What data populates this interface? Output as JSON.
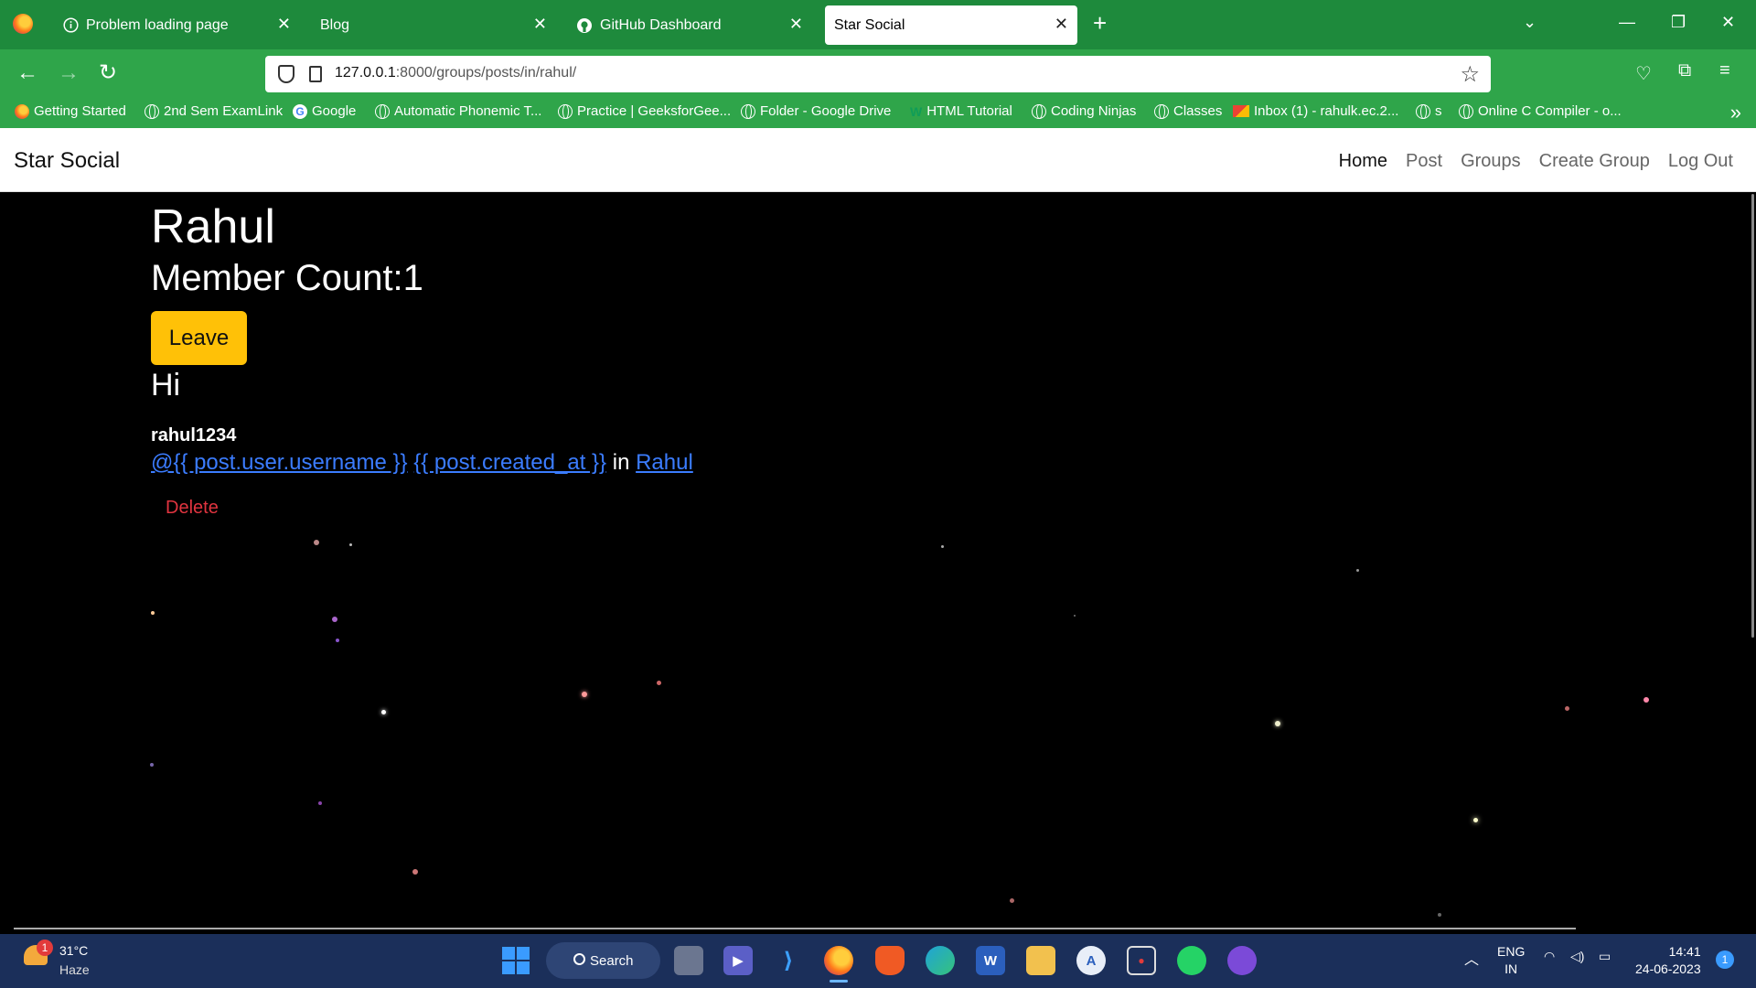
{
  "browser": {
    "tabs": [
      {
        "title": "Problem loading page",
        "icon": "info-icon",
        "active": false
      },
      {
        "title": "Blog",
        "icon": "none",
        "active": false
      },
      {
        "title": "GitHub Dashboard",
        "icon": "github-icon",
        "active": false
      },
      {
        "title": "Star Social",
        "icon": "none",
        "active": true
      }
    ],
    "url_host": "127.0.0.1",
    "url_rest": ":8000/groups/posts/in/rahul/",
    "bookmarks": [
      {
        "label": "Getting Started",
        "icon": "firefox-icon"
      },
      {
        "label": "2nd Sem ExamLink",
        "icon": "globe-icon"
      },
      {
        "label": "Google",
        "icon": "google-icon"
      },
      {
        "label": "Automatic Phonemic T...",
        "icon": "globe-icon"
      },
      {
        "label": "Practice | GeeksforGee...",
        "icon": "globe-icon"
      },
      {
        "label": "Folder - Google Drive",
        "icon": "globe-icon"
      },
      {
        "label": "HTML Tutorial",
        "icon": "w3schools-icon"
      },
      {
        "label": "Coding Ninjas",
        "icon": "globe-icon"
      },
      {
        "label": "Classes",
        "icon": "globe-icon"
      },
      {
        "label": "Inbox (1) - rahulk.ec.2...",
        "icon": "gmail-icon"
      },
      {
        "label": "s",
        "icon": "globe-icon"
      },
      {
        "label": "Online C Compiler - o...",
        "icon": "globe-icon"
      }
    ]
  },
  "site": {
    "brand": "Star Social",
    "nav": [
      {
        "label": "Home",
        "active": true
      },
      {
        "label": "Post",
        "active": false
      },
      {
        "label": "Groups",
        "active": false
      },
      {
        "label": "Create Group",
        "active": false
      },
      {
        "label": "Log Out",
        "active": false
      }
    ]
  },
  "group": {
    "name": "Rahul",
    "member_count": "Member Count:1",
    "leave_label": "Leave"
  },
  "post": {
    "message": "Hi",
    "username": "rahul1234",
    "user_link": "@{{ post.user.username }}",
    "date_link": "{{ post.created_at }}",
    "in_text": "in",
    "group_link": "Rahul",
    "delete_label": "Delete"
  },
  "taskbar": {
    "weather_badge": "1",
    "weather_temp": "31°C",
    "weather_desc": "Haze",
    "search_label": "Search",
    "lang_line1": "ENG",
    "lang_line2": "IN",
    "time": "14:41",
    "date": "24-06-2023",
    "notifications": "1"
  },
  "colors": {
    "chrome_green": "#1e8a3c",
    "toolbar_green": "#2fa54a",
    "leave_button": "#ffc107",
    "link_blue": "#3b7cff",
    "delete_red": "#e0343f"
  }
}
